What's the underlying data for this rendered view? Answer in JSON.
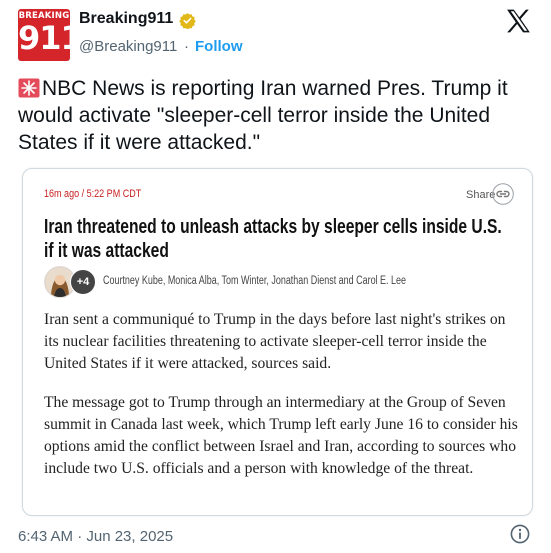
{
  "account": {
    "avatar_top": "BREAKING",
    "avatar_number": "911",
    "display_name": "Breaking911",
    "handle": "@Breaking911",
    "separator": "·",
    "follow_label": "Follow"
  },
  "tweet": {
    "text": "NBC News is reporting Iran warned Pres. Trump it would activate \"sleeper-cell terror inside the United States if it were attacked.\"",
    "timestamp": "6:43 AM · Jun 23, 2025"
  },
  "card": {
    "time": "16m ago / 5:22 PM CDT",
    "share_label": "Share",
    "headline": "Iran threatened to unleash attacks by sleeper cells inside U.S. if it was attacked",
    "author_count": "+4",
    "authors": "Courtney Kube, Monica Alba, Tom Winter, Jonathan Dienst and Carol E. Lee",
    "paragraph1": "Iran sent a communiqué to Trump in the days before last night's strikes on its nuclear facilities threatening to activate sleeper-cell terror inside the United States if it were attacked, sources said.",
    "paragraph2": "The message got to Trump through an intermediary at the Group of Seven summit in Canada last week, which Trump left early June 16 to consider his options amid the conflict between Israel and Iran, according to sources who include two U.S. officials and a person with knowledge of the threat."
  },
  "icons": {
    "verified": "verified-badge-icon",
    "x_logo": "x-logo-icon",
    "siren": "siren-icon",
    "share": "link-icon",
    "info": "info-icon"
  },
  "colors": {
    "follow": "#1d9bf0",
    "verified": "#e2b719",
    "avatar": "#d4252b",
    "card_time": "#c81e1e"
  }
}
